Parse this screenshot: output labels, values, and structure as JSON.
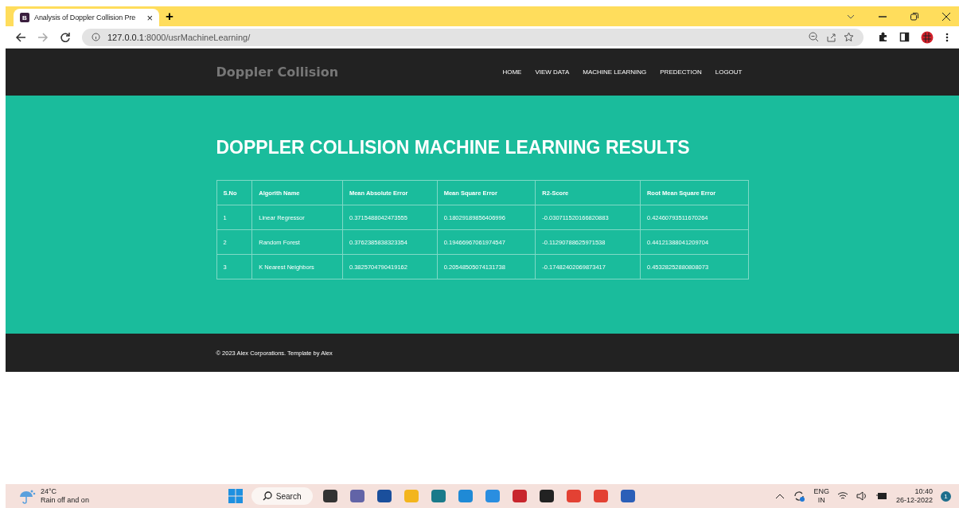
{
  "browser": {
    "tab": {
      "favicon": "B",
      "title": "Analysis of Doppler Collision Pre",
      "close": "×",
      "selected": true
    },
    "new_tab": "+",
    "url_host": "127.0.0.1",
    "url_path": ":8000/usrMachineLearning/"
  },
  "navbar": {
    "brand": "Doppler Collision",
    "links": [
      {
        "label": "HOME"
      },
      {
        "label": "VIEW DATA"
      },
      {
        "label": "MACHINE LEARNING"
      },
      {
        "label": "PREDECTION"
      },
      {
        "label": "LOGOUT"
      }
    ]
  },
  "heading": "DOPPLER COLLISION MACHINE LEARNING RESULTS",
  "table": {
    "columns": [
      "S.No",
      "Algorith Name",
      "Mean Absolute Error",
      "Mean Square Error",
      "R2-Score",
      "Root Mean Square Error"
    ],
    "rows": [
      [
        "1",
        "Linear Regressor",
        "0.3715488042473555",
        "0.18029189856406996",
        "-0.030711520166820883",
        "0.42460793511670264"
      ],
      [
        "2",
        "Random Forest",
        "0.3762385838323354",
        "0.19466967061974547",
        "-0.11290788625971538",
        "0.44121388041209704"
      ],
      [
        "3",
        "K Nearest Neighbors",
        "0.3825704790419162",
        "0.20548505074131738",
        "-0.17482402069873417",
        "0.45328252880808073"
      ]
    ]
  },
  "footer": "© 2023 Alex Corporations. Template by Alex",
  "taskbar": {
    "weather": {
      "temp": "24°C",
      "text": "Rain off and on"
    },
    "search": "Search",
    "lang": "ENG",
    "region": "IN",
    "time": "10:40",
    "date": "26-12-2022",
    "badge": "1"
  }
}
